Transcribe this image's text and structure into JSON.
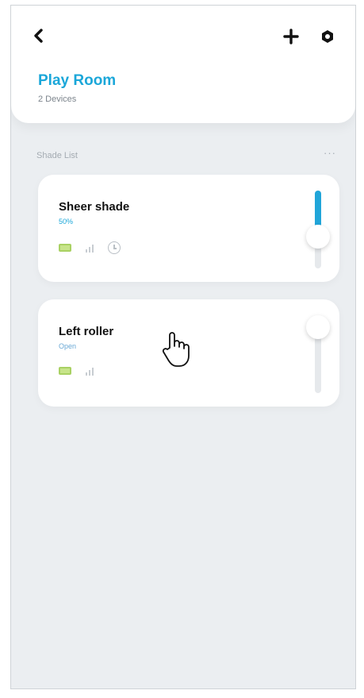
{
  "room": {
    "title": "Play Room",
    "subtitle": "2 Devices"
  },
  "header": {
    "back_icon": "chevron-left-icon",
    "add_icon": "plus-icon",
    "settings_icon": "gear-icon"
  },
  "section": {
    "label": "Shade List",
    "more": "···"
  },
  "devices": [
    {
      "name": "Sheer shade",
      "status": "50%",
      "level": 0.5,
      "icons": [
        "battery-icon",
        "signal-icon",
        "clock-icon"
      ]
    },
    {
      "name": "Left roller",
      "status": "Open",
      "level": 0.0,
      "icons": [
        "battery-icon",
        "signal-icon"
      ]
    }
  ],
  "colors": {
    "accent": "#1ba7d9",
    "background": "#ebeef1",
    "battery": "#a9d163"
  }
}
